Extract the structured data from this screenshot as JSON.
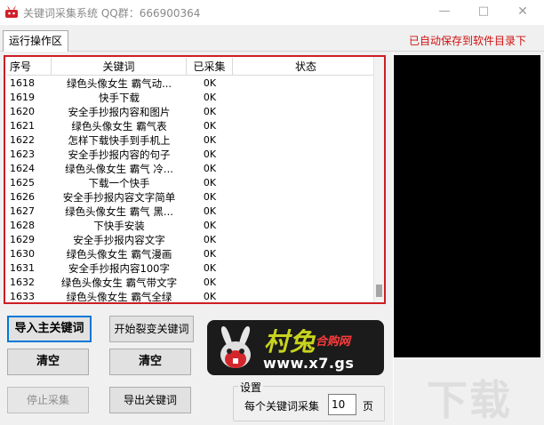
{
  "window": {
    "title": "关键词采集系统 QQ群：666900364",
    "minimize": "—",
    "maximize": "□",
    "close": "✕"
  },
  "tab": {
    "label": "运行操作区"
  },
  "autosave_notice": "已自动保存到软件目录下",
  "table": {
    "columns": [
      "序号",
      "关键词",
      "已采集",
      "状态"
    ],
    "rows": [
      [
        "1618",
        "绿色头像女生 霸气动...",
        "0K",
        ""
      ],
      [
        "1619",
        "快手下载",
        "0K",
        ""
      ],
      [
        "1620",
        "安全手抄报内容和图片",
        "0K",
        ""
      ],
      [
        "1621",
        "绿色头像女生 霸气表",
        "0K",
        ""
      ],
      [
        "1622",
        "怎样下载快手到手机上",
        "0K",
        ""
      ],
      [
        "1623",
        "安全手抄报内容的句子",
        "0K",
        ""
      ],
      [
        "1624",
        "绿色头像女生 霸气 冷...",
        "0K",
        ""
      ],
      [
        "1625",
        "下载一个快手",
        "0K",
        ""
      ],
      [
        "1626",
        "安全手抄报内容文字简单",
        "0K",
        ""
      ],
      [
        "1627",
        "绿色头像女生 霸气 黑...",
        "0K",
        ""
      ],
      [
        "1628",
        "下快手安装",
        "0K",
        ""
      ],
      [
        "1629",
        "安全手抄报内容文字",
        "0K",
        ""
      ],
      [
        "1630",
        "绿色头像女生 霸气漫画",
        "0K",
        ""
      ],
      [
        "1631",
        "安全手抄报内容100字",
        "0K",
        ""
      ],
      [
        "1632",
        "绿色头像女生 霸气带文字",
        "0K",
        ""
      ],
      [
        "1633",
        "绿色头像女生 霸气全绿",
        "0K",
        ""
      ]
    ]
  },
  "buttons": {
    "import_main": "导入主关键词",
    "start_split": "开始裂变关键词",
    "clear_left": "清空",
    "clear_right": "清空",
    "stop": "停止采集",
    "export": "导出关键词"
  },
  "logo": {
    "name": "村兔",
    "sub": "合购网",
    "url": "www.x7.gs"
  },
  "settings": {
    "title": "设置",
    "per_keyword_label": "每个关键词采集",
    "pages_value": "10",
    "unit": "页"
  },
  "watermark": "下载",
  "colors": {
    "highlight_border": "#cc1e24",
    "autosave_text": "#d01010",
    "log_bg": "#000000"
  }
}
